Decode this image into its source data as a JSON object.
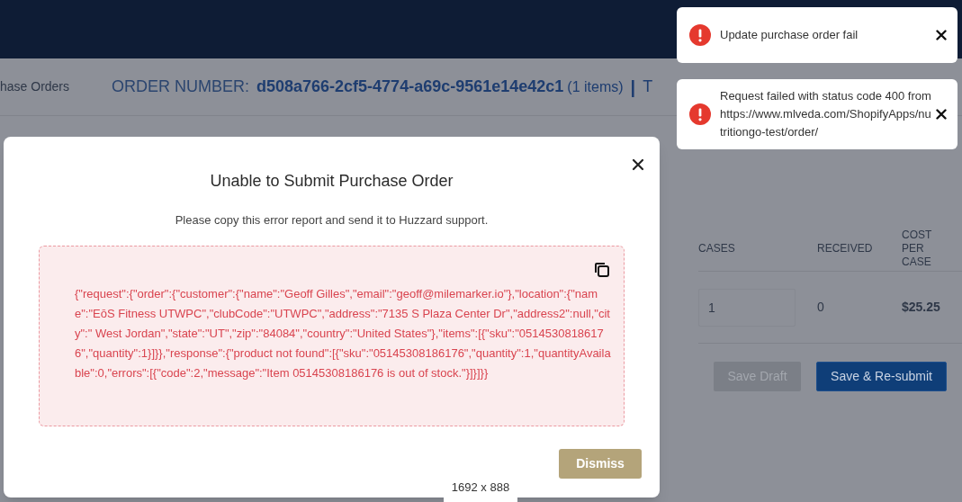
{
  "page": {
    "breadcrumb": "hase Orders",
    "order_label": "ORDER NUMBER:",
    "order_number": "d508a766-2cf5-4774-a69c-9561e14e42c1",
    "item_count": "(1 items)",
    "separator": "|",
    "cut_text": "T"
  },
  "table": {
    "columns": [
      "CASES",
      "RECEIVED",
      "COST PER CASE"
    ],
    "rows": [
      {
        "cases": "1",
        "received": "0",
        "cost": "$25.25"
      }
    ]
  },
  "buttons": [
    {
      "label": "Save Draft",
      "disabled": true
    },
    {
      "label": "Save & Re-submit",
      "disabled": false
    }
  ],
  "modal": {
    "title": "Unable to Submit Purchase Order",
    "message": "Please copy this error report and send it to Huzzard support.",
    "error_report": "{\"request\":{\"order\":{\"customer\":{\"name\":\"Geoff Gilles\",\"email\":\"geoff@milemarker.io\"},\"location\":{\"name\":\"EōS Fitness UTWPC\",\"clubCode\":\"UTWPC\",\"address\":\"7135 S Plaza Center Dr\",\"address2\":null,\"city\":\" West Jordan\",\"state\":\"UT\",\"zip\":\"84084\",\"country\":\"United States\"},\"items\":[{\"sku\":\"05145308186176\",\"quantity\":1}]}},\"response\":{\"product not found\":[{\"sku\":\"05145308186176\",\"quantity\":1,\"quantityAvailable\":0,\"errors\":[{\"code\":2,\"message\":\"Item 05145308186176 is out of stock.\"}]}]}}",
    "dismiss": "Dismiss"
  },
  "toasts": [
    {
      "message": "Update purchase order fail"
    },
    {
      "message": "Request failed with status code 400 from https://www.mlveda.com/ShopifyApps/nutritiongo-test/order/"
    }
  ],
  "size_label": "1692 x 888"
}
